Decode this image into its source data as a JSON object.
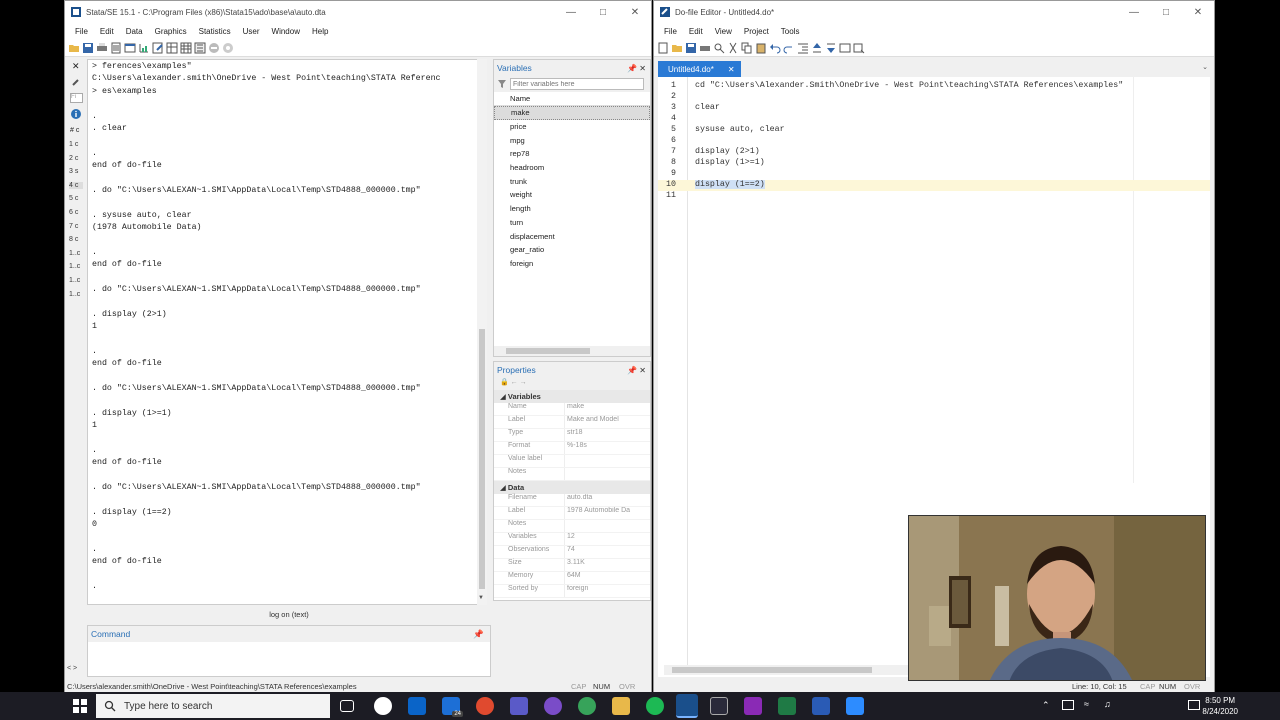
{
  "stata": {
    "title": "Stata/SE 15.1 - C:\\Program Files (x86)\\Stata15\\ado\\base\\a\\auto.dta",
    "menu": [
      "File",
      "Edit",
      "Data",
      "Graphics",
      "Statistics",
      "User",
      "Window",
      "Help"
    ],
    "results": [
      "> ferences\\examples\"",
      "C:\\Users\\alexander.smith\\OneDrive - West Point\\teaching\\STATA Referenc",
      "> es\\examples",
      "",
      ".",
      ". clear",
      "",
      ".",
      "end of do-file",
      "",
      ". do \"C:\\Users\\ALEXAN~1.SMI\\AppData\\Local\\Temp\\STD4888_000000.tmp\"",
      "",
      ". sysuse auto, clear",
      "(1978 Automobile Data)",
      "",
      ".",
      "end of do-file",
      "",
      ". do \"C:\\Users\\ALEXAN~1.SMI\\AppData\\Local\\Temp\\STD4888_000000.tmp\"",
      "",
      ". display (2>1)",
      "1",
      "",
      ".",
      "end of do-file",
      "",
      ". do \"C:\\Users\\ALEXAN~1.SMI\\AppData\\Local\\Temp\\STD4888_000000.tmp\"",
      "",
      ". display (1>=1)",
      "1",
      "",
      ".",
      "end of do-file",
      "",
      ". do \"C:\\Users\\ALEXAN~1.SMI\\AppData\\Local\\Temp\\STD4888_000000.tmp\"",
      "",
      ". display (1==2)",
      "0",
      "",
      ".",
      "end of do-file",
      "",
      "."
    ],
    "history_items": [
      "1 c",
      "2 c",
      "3 s",
      "4 c",
      "5 c",
      "6 c",
      "7 c",
      "8 c",
      "1..c",
      "1..c",
      "1..c",
      "1..c"
    ],
    "log_status": "log on (text)",
    "variables_title": "Variables",
    "variables_filter_placeholder": "Filter variables here",
    "variables_col": "Name",
    "variables": [
      "make",
      "price",
      "mpg",
      "rep78",
      "headroom",
      "trunk",
      "weight",
      "length",
      "turn",
      "displacement",
      "gear_ratio",
      "foreign"
    ],
    "properties_title": "Properties",
    "prop_variables_section": "Variables",
    "prop_variables": [
      {
        "k": "Name",
        "v": "make"
      },
      {
        "k": "Label",
        "v": "Make and Model"
      },
      {
        "k": "Type",
        "v": "str18"
      },
      {
        "k": "Format",
        "v": "%-18s"
      },
      {
        "k": "Value label",
        "v": ""
      },
      {
        "k": "Notes",
        "v": ""
      }
    ],
    "prop_data_section": "Data",
    "prop_data": [
      {
        "k": "Filename",
        "v": "auto.dta"
      },
      {
        "k": "Label",
        "v": "1978 Automobile Da"
      },
      {
        "k": "Notes",
        "v": ""
      },
      {
        "k": "Variables",
        "v": "12"
      },
      {
        "k": "Observations",
        "v": "74"
      },
      {
        "k": "Size",
        "v": "3.11K"
      },
      {
        "k": "Memory",
        "v": "64M"
      },
      {
        "k": "Sorted by",
        "v": "foreign"
      }
    ],
    "command_title": "Command",
    "status_path": "C:\\Users\\alexander.smith\\OneDrive - West Point\\teaching\\STATA References\\examples",
    "status_caps": "CAP",
    "status_num": "NUM",
    "status_ovr": "OVR"
  },
  "dofile": {
    "title": "Do-file Editor - Untitled4.do*",
    "menu": [
      "File",
      "Edit",
      "View",
      "Project",
      "Tools"
    ],
    "tab": "Untitled4.do*",
    "lines": [
      "cd \"C:\\Users\\Alexander.Smith\\OneDrive - West Point\\teaching\\STATA References\\examples\"",
      "",
      "clear",
      "",
      "sysuse auto, clear",
      "",
      "display (2>1)",
      "display (1>=1)",
      "",
      "display (1==2)",
      ""
    ],
    "status_pos": "Line: 10, Col: 15",
    "status_caps": "CAP",
    "status_num": "NUM",
    "status_ovr": "OVR"
  },
  "taskbar": {
    "search_placeholder": "Type here to search",
    "badge": "24",
    "time": "8:50 PM",
    "date": "8/24/2020"
  }
}
